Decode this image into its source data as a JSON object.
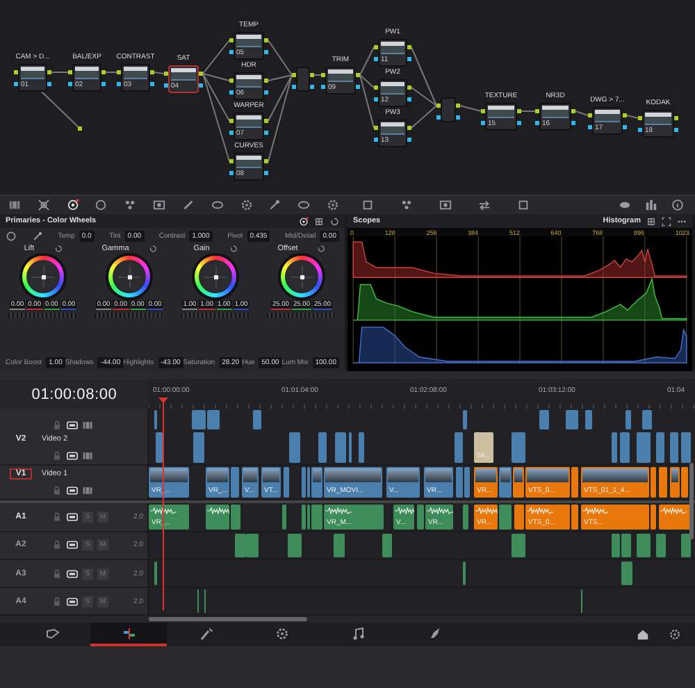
{
  "nodes": [
    {
      "kind": "node",
      "label": "CAM > D...",
      "number": "01",
      "selected": false
    },
    {
      "kind": "node",
      "label": "BAL/EXP",
      "number": "02",
      "selected": false
    },
    {
      "kind": "node",
      "label": "CONTRAST",
      "number": "03",
      "selected": false
    },
    {
      "kind": "node",
      "label": "SAT",
      "number": "04",
      "selected": true
    },
    {
      "kind": "node",
      "label": "TEMP",
      "number": "05",
      "selected": false
    },
    {
      "kind": "node",
      "label": "HDR",
      "number": "06",
      "selected": false
    },
    {
      "kind": "node",
      "label": "WARPER",
      "number": "07",
      "selected": false
    },
    {
      "kind": "node",
      "label": "CURVES",
      "number": "08",
      "selected": false
    },
    {
      "kind": "mixer",
      "selected": false
    },
    {
      "kind": "node",
      "label": "TRIM",
      "number": "09",
      "selected": false
    },
    {
      "kind": "node",
      "label": "PW1",
      "number": "11",
      "selected": false
    },
    {
      "kind": "node",
      "label": "PW2",
      "number": "12",
      "selected": false
    },
    {
      "kind": "node",
      "label": "PW3",
      "number": "13",
      "selected": false
    },
    {
      "kind": "mixer",
      "selected": false
    },
    {
      "kind": "node",
      "label": "TEXTURE",
      "number": "15",
      "selected": false
    },
    {
      "kind": "node",
      "label": "NR3D",
      "number": "16",
      "selected": false
    },
    {
      "kind": "node",
      "label": "DWG > 7...",
      "number": "17",
      "selected": false
    },
    {
      "kind": "node",
      "label": "KODAK",
      "number": "18",
      "selected": false
    }
  ],
  "color_panel": {
    "title": "Primaries - Color Wheels",
    "adjustments": [
      {
        "label": "Temp",
        "value": "0.0"
      },
      {
        "label": "Tint",
        "value": "0.00"
      },
      {
        "label": "Contrast",
        "value": "1.000"
      },
      {
        "label": "Pivot",
        "value": "0.435"
      },
      {
        "label": "Mid/Detail",
        "value": "0.00"
      }
    ],
    "wheels": [
      {
        "label": "Lift",
        "values": [
          "0.00",
          "0.00",
          "0.00",
          "0.00"
        ]
      },
      {
        "label": "Gamma",
        "values": [
          "0.00",
          "0.00",
          "0.00",
          "0.00"
        ]
      },
      {
        "label": "Gain",
        "values": [
          "1.00",
          "1.00",
          "1.00",
          "1.00"
        ]
      },
      {
        "label": "Offset",
        "values": [
          "25.00",
          "25.00",
          "25.00"
        ]
      }
    ],
    "bottom_adjustments": [
      {
        "label": "Color Boost",
        "value": "1.00"
      },
      {
        "label": "Shadows",
        "value": "-44.00"
      },
      {
        "label": "Highlights",
        "value": "-43.00"
      },
      {
        "label": "Saturation",
        "value": "28.20"
      },
      {
        "label": "Hue",
        "value": "50.00"
      },
      {
        "label": "Lum Mix",
        "value": "100.00"
      }
    ]
  },
  "scopes": {
    "title": "Scopes",
    "mode": "Histogram",
    "ticks": [
      "0",
      "128",
      "256",
      "384",
      "512",
      "640",
      "768",
      "896",
      "1023"
    ]
  },
  "timeline": {
    "timecode": "01:00:08:00",
    "ruler": [
      "01:00:00:00",
      "01:01:04:00",
      "01:02:08:00",
      "01:03:12:00",
      "01:04"
    ],
    "video_tracks": [
      {
        "clips": [
          {
            "color": "#4a7fae"
          },
          {
            "color": "#4a7fae"
          },
          {
            "color": "#4a7fae"
          },
          {
            "color": "#4a7fae"
          },
          {
            "color": "#4a7fae"
          },
          {
            "color": "#4a7fae"
          },
          {
            "color": "#4a7fae"
          },
          {
            "color": "#4a7fae"
          },
          {
            "color": "#4a7fae"
          },
          {
            "color": "#4a7fae"
          }
        ]
      },
      {
        "code": "V2",
        "name": "Video 2",
        "selected": false,
        "clips": [
          {
            "color": "#4a7fae"
          },
          {
            "color": "#4a7fae"
          },
          {
            "color": "#4a7fae"
          },
          {
            "color": "#4a7fae"
          },
          {
            "color": "#4a7fae"
          },
          {
            "color": "#4a7fae"
          },
          {
            "color": "#4a7fae"
          },
          {
            "color": "#4a7fae"
          },
          {
            "color": "#cbbf9f",
            "label": "Sil..."
          },
          {
            "color": "#4a7fae"
          },
          {
            "color": "#4a7fae"
          },
          {
            "color": "#4a7fae"
          },
          {
            "color": "#4a7fae"
          },
          {
            "color": "#4a7fae"
          },
          {
            "color": "#4a7fae"
          },
          {
            "color": "#4a7fae"
          }
        ]
      },
      {
        "code": "V1",
        "name": "Video 1",
        "selected": true,
        "clips": [
          {
            "color": "#4a7fae",
            "label": "VR_..."
          },
          {
            "color": "#4a7fae",
            "label": "VR_..."
          },
          {
            "color": "#4a7fae"
          },
          {
            "color": "#4a7fae",
            "label": "V..."
          },
          {
            "color": "#4a7fae",
            "label": "VT..."
          },
          {
            "color": "#4a7fae"
          },
          {
            "color": "#4a7fae"
          },
          {
            "color": "#4a7fae"
          },
          {
            "color": "#4a7fae"
          },
          {
            "color": "#4a7fae",
            "label": "VR_MOVI..."
          },
          {
            "color": "#4a7fae",
            "label": "V..."
          },
          {
            "color": "#4a7fae",
            "label": "VR..."
          },
          {
            "color": "#4a7fae"
          },
          {
            "color": "#4a7fae"
          },
          {
            "color": "#e8780c",
            "label": "VR..."
          },
          {
            "color": "#4a7fae"
          },
          {
            "color": "#e8780c"
          },
          {
            "color": "#e8780c",
            "label": "VTS_0..."
          },
          {
            "color": "#e8780c"
          },
          {
            "color": "#e8780c",
            "label": "VTS_01_1_4..."
          },
          {
            "color": "#e8780c"
          },
          {
            "color": "#e8780c"
          },
          {
            "color": "#e8780c"
          },
          {
            "color": "#e8780c"
          }
        ]
      }
    ],
    "audio_tracks": [
      {
        "code": "A1",
        "solo": "S",
        "mute": "M",
        "format": "2.0",
        "selected": true,
        "clips": [
          {
            "color": "#3d8c5a",
            "label": "VR_..."
          },
          {
            "color": "#3d8c5a"
          },
          {
            "color": "#3d8c5a"
          },
          {
            "color": "#3d8c5a"
          },
          {
            "color": "#3d8c5a"
          },
          {
            "color": "#3d8c5a"
          },
          {
            "color": "#3d8c5a"
          },
          {
            "color": "#3d8c5a",
            "label": "VR_M..."
          },
          {
            "color": "#3d8c5a",
            "label": "V..."
          },
          {
            "color": "#3d8c5a"
          },
          {
            "color": "#3d8c5a",
            "label": "VR..."
          },
          {
            "color": "#3d8c5a"
          },
          {
            "color": "#e8780c",
            "label": "VR..."
          },
          {
            "color": "#3d8c5a"
          },
          {
            "color": "#e8780c"
          },
          {
            "color": "#e8780c",
            "label": "VTS_0..."
          },
          {
            "color": "#e8780c"
          },
          {
            "color": "#e8780c",
            "label": "VTS..."
          },
          {
            "color": "#e8780c"
          },
          {
            "color": "#e8780c"
          }
        ]
      },
      {
        "code": "A2",
        "solo": "S",
        "mute": "M",
        "format": "2.0",
        "selected": false,
        "clips": [
          {
            "color": "#3d8c5a"
          },
          {
            "color": "#3d8c5a"
          },
          {
            "color": "#3d8c5a"
          },
          {
            "color": "#3d8c5a"
          },
          {
            "color": "#3d8c5a"
          },
          {
            "color": "#3d8c5a"
          },
          {
            "color": "#3d8c5a"
          },
          {
            "color": "#3d8c5a"
          },
          {
            "color": "#3d8c5a"
          },
          {
            "color": "#3d8c5a"
          },
          {
            "color": "#3d8c5a"
          }
        ]
      },
      {
        "code": "A3",
        "solo": "S",
        "mute": "M",
        "format": "2.0",
        "selected": false,
        "clips": [
          {
            "color": "#3d8c5a"
          },
          {
            "color": "#3d8c5a"
          },
          {
            "color": "#3d8c5a"
          }
        ]
      },
      {
        "code": "A4",
        "solo": "S",
        "mute": "M",
        "format": "2.0",
        "selected": false,
        "clips": [
          {
            "color": "#3d8c5a"
          },
          {
            "color": "#3d8c5a"
          },
          {
            "color": "#3d8c5a"
          }
        ]
      }
    ]
  },
  "pages": [
    {
      "kind": "media",
      "selected": false
    },
    {
      "kind": "edit",
      "selected": true
    },
    {
      "kind": "fusion",
      "selected": false
    },
    {
      "kind": "color",
      "selected": false
    },
    {
      "kind": "fairlight",
      "selected": false
    },
    {
      "kind": "deliver",
      "selected": false
    }
  ]
}
